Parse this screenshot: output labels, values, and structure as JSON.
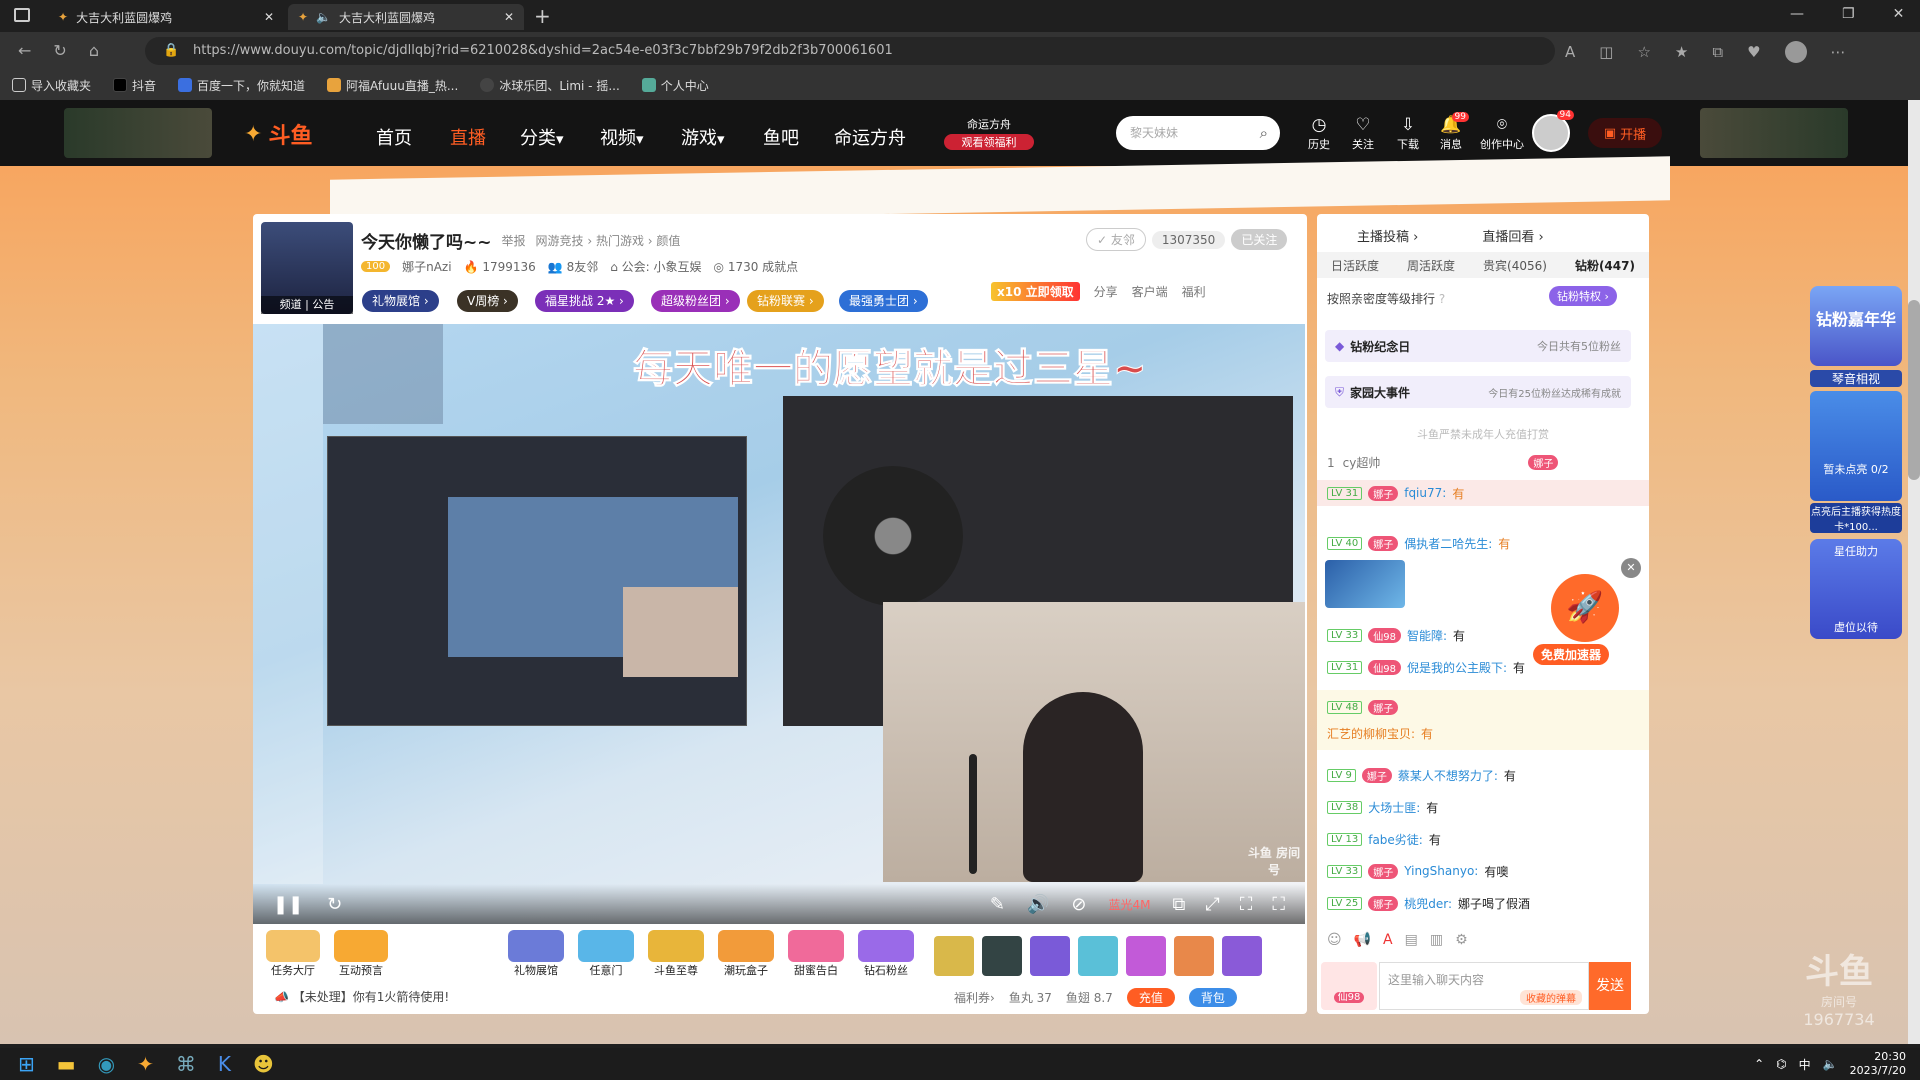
{
  "browser": {
    "tabs": [
      {
        "title": "大吉大利蓝圆爆鸡"
      },
      {
        "title": "大吉大利蓝圆爆鸡"
      }
    ],
    "url": "https://www.douyu.com/topic/djdllqbj?rid=6210028&dyshid=2ac54e-e03f3c7bbf29b79f2db2f3b700061601",
    "bookmarks": [
      "导入收藏夹",
      "抖音",
      "百度一下，你就知道",
      "阿福Afuuu直播_热...",
      "冰球乐团、Limi - 摇...",
      "个人中心"
    ]
  },
  "site": {
    "logo": "斗鱼",
    "nav": [
      "首页",
      "直播",
      "分类",
      "视频",
      "游戏",
      "鱼吧",
      "命运方舟"
    ],
    "promo": {
      "line1": "命运方舟",
      "line2": "观看领福利"
    },
    "search_placeholder": "黎天妹妹",
    "icons": [
      {
        "label": "历史",
        "glyph": "◷"
      },
      {
        "label": "关注",
        "glyph": "♡"
      },
      {
        "label": "下载",
        "glyph": "⇩"
      },
      {
        "label": "消息",
        "glyph": "🔔",
        "badge": "99"
      },
      {
        "label": "创作中心",
        "glyph": "⌾"
      }
    ],
    "avatar_badge": "94",
    "live_button": "开播"
  },
  "room": {
    "title": "今天你懒了吗~~",
    "report": "举报",
    "crumbs": "网游竞技 › 热门游戏 › 颜值",
    "streamer": "娜子nAzi",
    "heat": "1799136",
    "friends": "8友邻",
    "guild": "公会: 小象互娱",
    "achievements": "1730 成就点",
    "friend_btn": "✓ 友邻",
    "followers": "1307350",
    "followed_btn": "已关注",
    "avatar_caption": "频道 | 公告",
    "tags": [
      "礼物展馆 ›",
      "V周榜 ›",
      "福星挑战 2★ ›",
      "超级粉丝团 ›",
      "钻粉联赛 ›",
      "最强勇士团 ›"
    ],
    "actions": [
      "分享",
      "客户端",
      "福利"
    ],
    "gift_promo": "x10 立即领取",
    "video_overlay_text": "每天唯一的愿望就是过三星~",
    "watermark": "斗鱼 房间号",
    "quality": "蓝光4M"
  },
  "gifts": {
    "left": [
      "任务大厅",
      "互动预言"
    ],
    "mid": [
      "礼物展馆",
      "任意门",
      "斗鱼至尊",
      "潮玩盒子",
      "甜蜜告白",
      "钻石粉丝"
    ],
    "notice": "【未处理】你有1火箭待使用!",
    "bottom": {
      "welfare": "福利券›",
      "fish_ball": "鱼丸 37",
      "fish_fin": "鱼翅 8.7",
      "recharge": "充值",
      "bag": "背包"
    }
  },
  "chat": {
    "top_links": [
      "主播投稿 ›",
      "直播回看 ›"
    ],
    "tabs": [
      "日活跃度",
      "周活跃度",
      "贵宾(4056)",
      "钻粉(447)"
    ],
    "sort_label": "按照亲密度等级排行",
    "diamond_priv": "钻粉特权 ›",
    "events": [
      {
        "title": "钻粉纪念日",
        "desc": "今日共有5位粉丝"
      },
      {
        "title": "家园大事件",
        "desc": "今日有25位粉丝达成稀有成就"
      }
    ],
    "notice": "斗鱼严禁未成年人充值打赏",
    "rank1": {
      "rank": "1",
      "name": "cy超帅",
      "badge": "娜子"
    },
    "messages": [
      {
        "lv": "LV 31",
        "fan": "娜子",
        "user": "fqiu77:",
        "text": "有"
      },
      {
        "lv": "LV 40",
        "fan": "娜子",
        "user": "偶执者二哈先生:",
        "text": "有"
      },
      {
        "lv": "LV 33",
        "fan": "仙98",
        "user": "智能障:",
        "text": "有"
      },
      {
        "lv": "LV 31",
        "fan": "仙98",
        "user": "倪是我的公主殿下:",
        "text": "有"
      },
      {
        "lv": "LV 48",
        "fan": "娜子",
        "user": "汇艺的柳柳宝贝:",
        "text": "有"
      },
      {
        "lv": "LV 9",
        "fan": "娜子",
        "user": "蔡某人不想努力了:",
        "text": "有"
      },
      {
        "lv": "LV 38",
        "fan": "",
        "user": "大场士匪:",
        "text": "有"
      },
      {
        "lv": "LV 13",
        "fan": "",
        "user": "fabe劣徒:",
        "text": "有"
      },
      {
        "lv": "LV 33",
        "fan": "娜子",
        "user": "YingShanyo:",
        "text": "有噢"
      },
      {
        "lv": "LV 25",
        "fan": "娜子",
        "user": "桃兜der:",
        "text": "娜子喝了假酒"
      }
    ],
    "input_placeholder": "这里输入聊天内容",
    "barrage_btn": "收藏的弹幕",
    "send": "发送",
    "fan_badge": "仙98",
    "boost": "免费加速器"
  },
  "side": {
    "event": "钻粉嘉年华",
    "tab": "琴音相视",
    "progress": "暂未点亮 0/2",
    "desc": "点亮后主播获得热度卡*100...",
    "help": "星任助力",
    "wait": "虚位以待"
  },
  "room_watermark": {
    "logo": "斗鱼",
    "label": "房间号",
    "number": "1967734"
  },
  "taskbar": {
    "time": "20:30",
    "date": "2023/7/20",
    "ime": "中"
  }
}
